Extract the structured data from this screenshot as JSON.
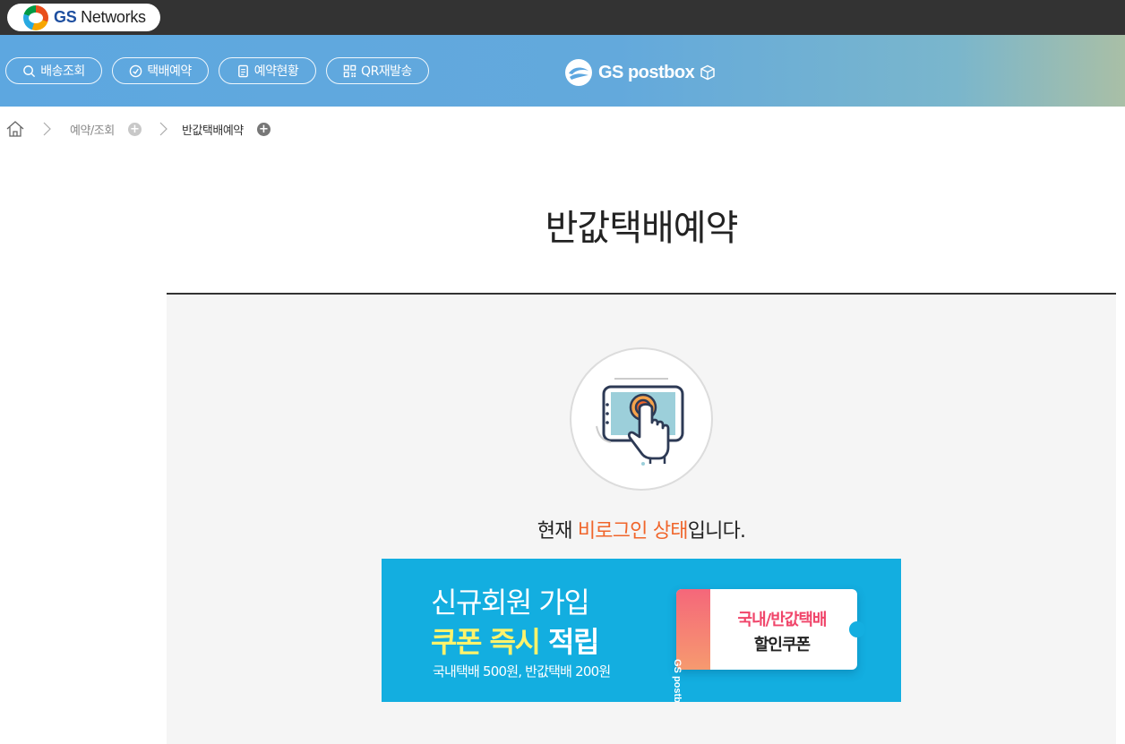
{
  "topbar": {
    "brand_gs": "GS",
    "brand_name": "Networks"
  },
  "nav": {
    "buttons": [
      {
        "label": "배송조회",
        "icon": "search-icon"
      },
      {
        "label": "택배예약",
        "icon": "clock-icon"
      },
      {
        "label": "예약현황",
        "icon": "document-icon"
      },
      {
        "label": "QR재발송",
        "icon": "qr-code-icon"
      }
    ],
    "logo_text": "GS postbox"
  },
  "breadcrumb": {
    "items": [
      "예약/조회",
      "반값택배예약"
    ]
  },
  "page": {
    "title": "반값택배예약",
    "status_prefix": "현재 ",
    "status_highlight": "비로그인 상태",
    "status_suffix": "입니다."
  },
  "promo": {
    "line1": "신규회원 가입",
    "line2_yellow": "쿠폰 즉시",
    "line2_white": " 적립",
    "line3": "국내택배 500원, 반값택배 200원",
    "coupon_brand": "GS postbox",
    "coupon_line1": "국내/반값택배",
    "coupon_line2": "할인쿠폰"
  },
  "colors": {
    "accent": "#f0652b",
    "promo_bg": "#13aee0",
    "promo_yellow": "#fff36b",
    "coupon_pink": "#f0456a"
  }
}
